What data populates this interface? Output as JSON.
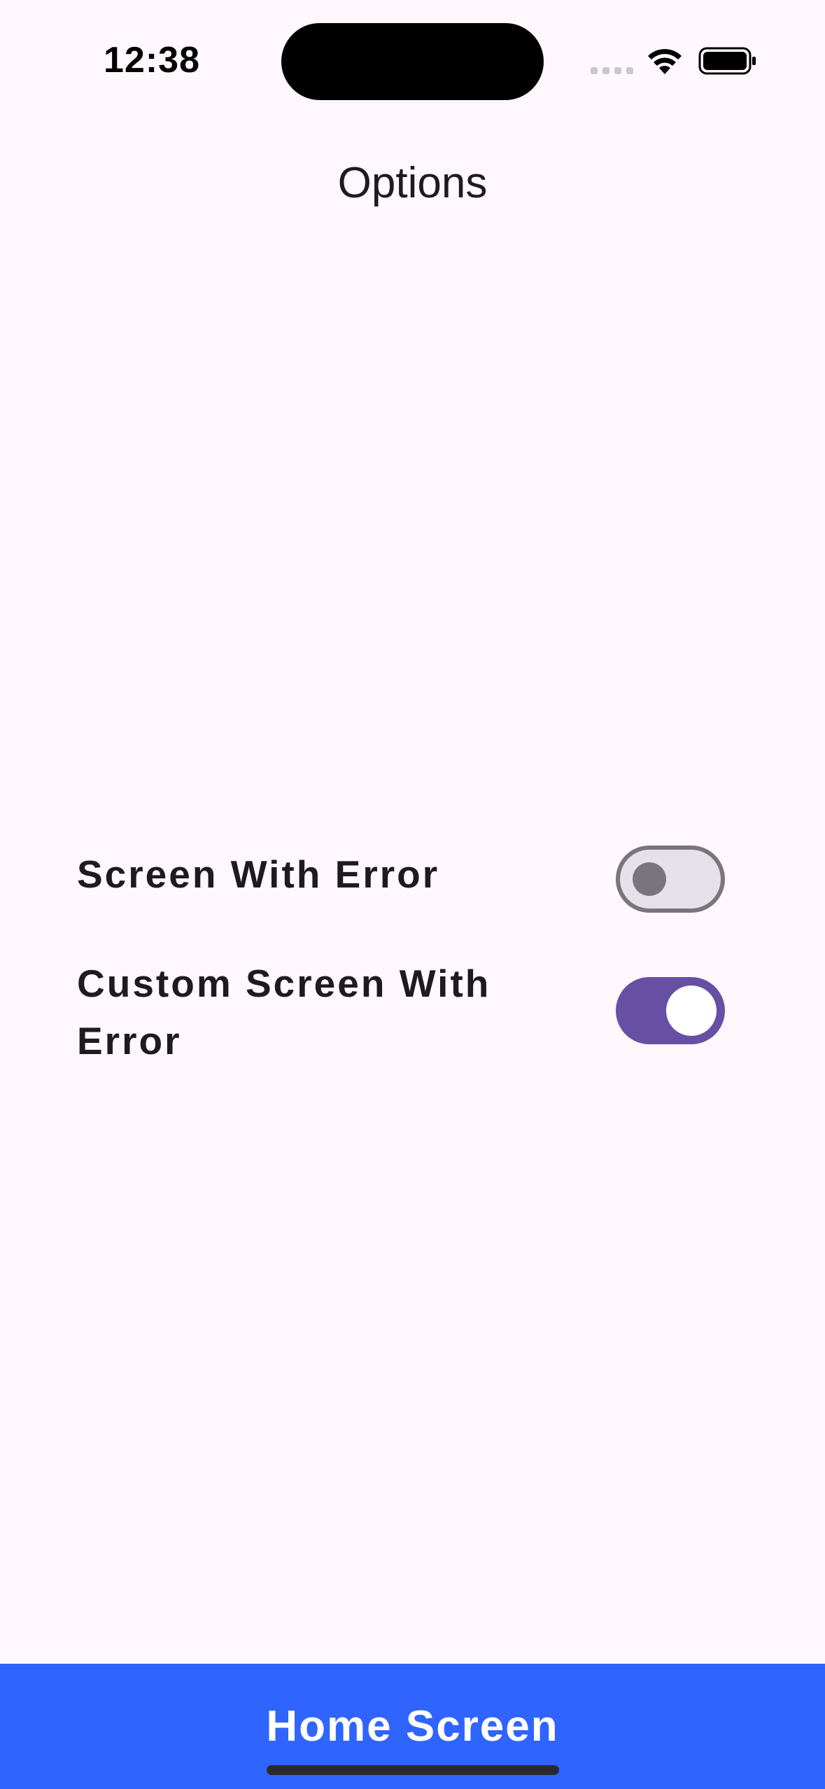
{
  "status_bar": {
    "time": "12:38",
    "signal_icon": "cellular-signal-icon",
    "wifi_icon": "wifi-icon",
    "battery_icon": "battery-icon"
  },
  "header": {
    "title": "Options"
  },
  "options": [
    {
      "label": "Screen With Error",
      "enabled": false
    },
    {
      "label": "Custom Screen With Error",
      "enabled": true
    }
  ],
  "bottom_button": {
    "label": "Home Screen",
    "color": "#2f64ff"
  },
  "colors": {
    "background": "#fef7fc",
    "toggle_on": "#6750a4",
    "toggle_off_track": "#e6e0e9",
    "toggle_off_outline": "#79747e"
  }
}
